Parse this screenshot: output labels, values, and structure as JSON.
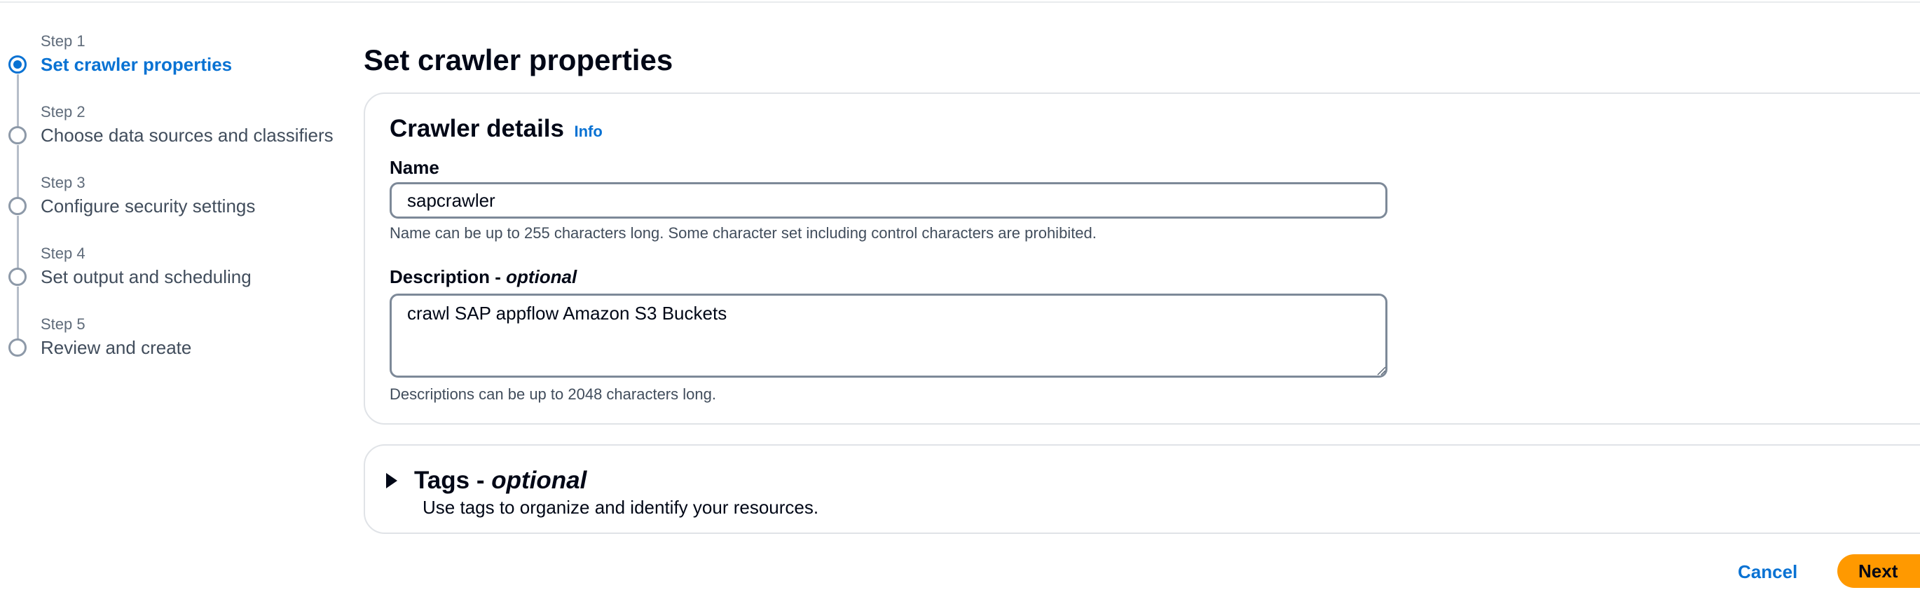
{
  "wizard": {
    "steps": [
      {
        "step": "Step 1",
        "title": "Set crawler properties",
        "active": true
      },
      {
        "step": "Step 2",
        "title": "Choose data sources and classifiers",
        "active": false
      },
      {
        "step": "Step 3",
        "title": "Configure security settings",
        "active": false
      },
      {
        "step": "Step 4",
        "title": "Set output and scheduling",
        "active": false
      },
      {
        "step": "Step 5",
        "title": "Review and create",
        "active": false
      }
    ]
  },
  "page": {
    "title": "Set crawler properties"
  },
  "crawler_details": {
    "heading": "Crawler details",
    "info_link": "Info",
    "name_label": "Name",
    "name_value": "sapcrawler",
    "name_hint": "Name can be up to 255 characters long. Some character set including control characters are prohibited.",
    "description_label": "Description - ",
    "description_label_optional": "optional",
    "description_value": "crawl SAP appflow Amazon S3 Buckets",
    "description_hint": "Descriptions can be up to 2048 characters long."
  },
  "tags": {
    "title": "Tags - ",
    "title_optional": "optional",
    "description": "Use tags to organize and identify your resources.",
    "expanded": false
  },
  "footer": {
    "cancel_label": "Cancel",
    "next_label": "Next"
  },
  "colors": {
    "accent": "#0972d3",
    "primary_button": "#ff9900",
    "text": "#000716",
    "muted": "#5f6b7a"
  }
}
